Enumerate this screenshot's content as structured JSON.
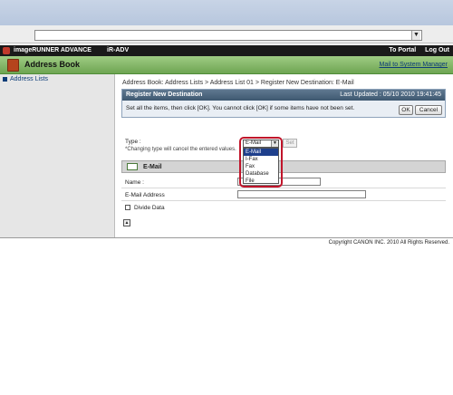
{
  "header": {
    "product": "imageRUNNER ADVANCE",
    "model": "iR-ADV",
    "to_portal": "To Portal",
    "log_out": "Log Out"
  },
  "titlebar": {
    "title": "Address Book",
    "mail_link": "Mail to System Manager"
  },
  "sidebar": {
    "items": [
      {
        "label": "Address Lists"
      }
    ]
  },
  "breadcrumb": "Address Book: Address Lists > Address List 01 > Register New Destination: E-Mail",
  "panel": {
    "title": "Register New Destination",
    "updated": "Last Updated : 05/10 2010 19:41:45",
    "message": "Set all the items, then click [OK]. You cannot click [OK] if some items have not been set.",
    "ok_label": "OK",
    "cancel_label": "Cancel"
  },
  "type_field": {
    "label": "Type :",
    "note": "*Changing type will cancel the entered values.",
    "selected": "E-Mail",
    "set_label": "Set",
    "options": [
      "E-Mail",
      "I-Fax",
      "Fax",
      "Database",
      "File"
    ]
  },
  "section": {
    "title": "E-Mail",
    "name_label": "Name :",
    "email_label": "E-Mail Address",
    "divide_label": "Divide Data"
  },
  "footer": {
    "copyright": "Copyright CANON INC. 2010 All Rights Reserved."
  }
}
